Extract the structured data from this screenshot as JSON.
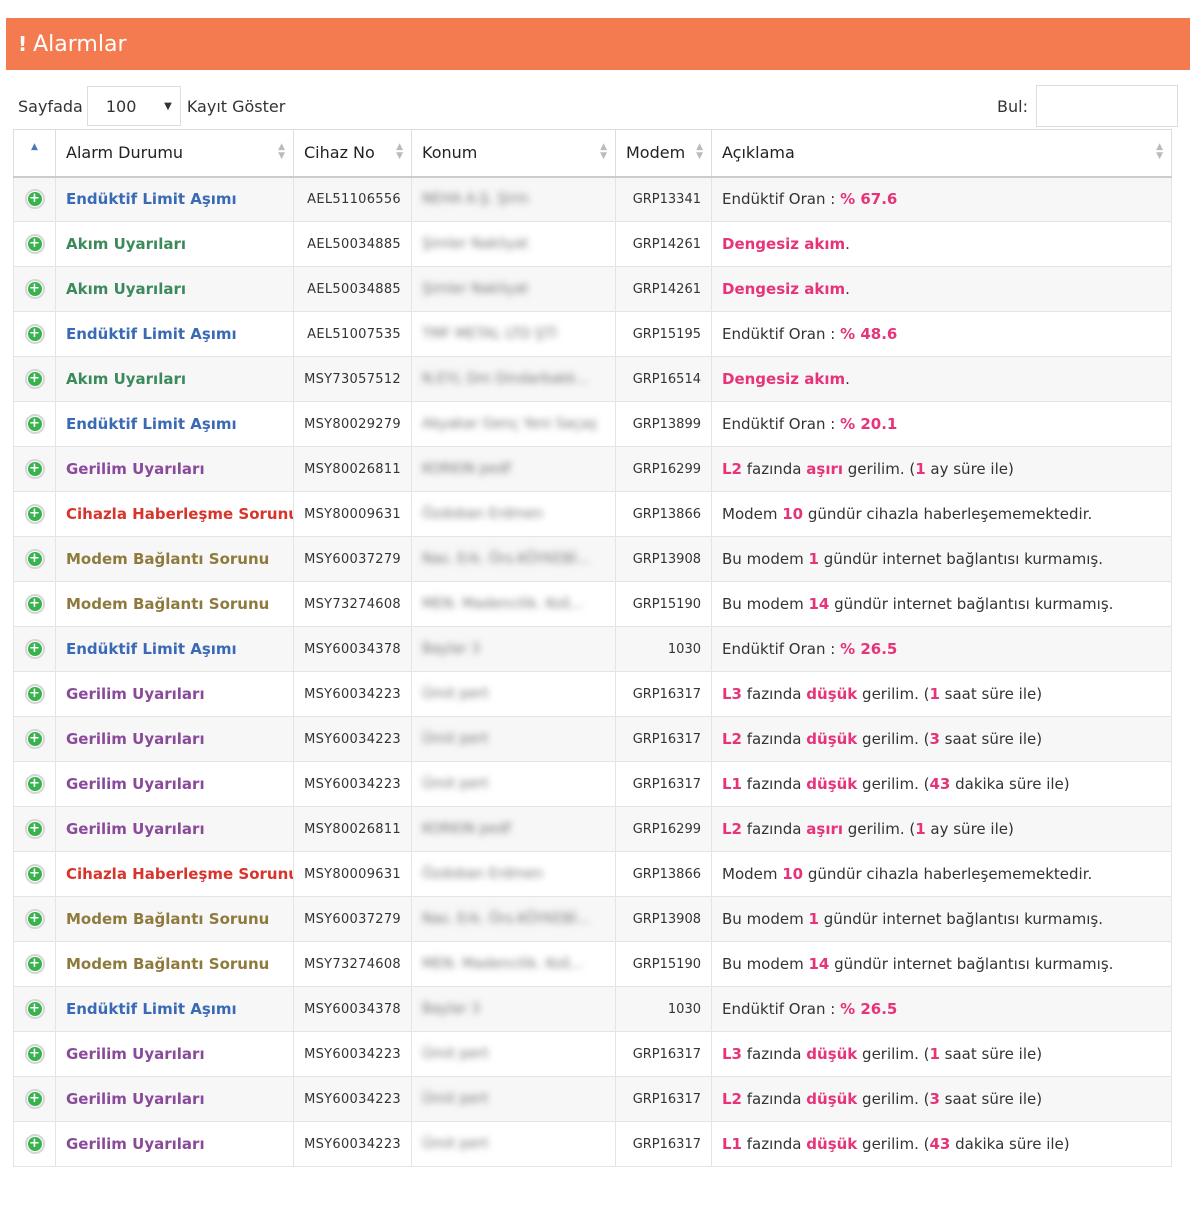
{
  "panel": {
    "title": "Alarmlar"
  },
  "length": {
    "prefix": "Sayfada",
    "value": "100",
    "suffix": "Kayıt Göster"
  },
  "search": {
    "label": "Bul:",
    "value": ""
  },
  "colors": {
    "header_bg": "#f47b4f",
    "Endüktif Limit Aşımı": "#3a6ab5",
    "Akım Uyarıları": "#3c8a5c",
    "Gerilim Uyarıları": "#8a4a9a",
    "Cihazla Haberleşme Sorunu": "#d9342b",
    "Modem Bağlantı Sorunu": "#8f7a3d",
    "highlight": "#e6337a"
  },
  "table": {
    "headers": [
      "",
      "Alarm Durumu",
      "Cihaz No",
      "Konum",
      "Modem",
      "Açıklama"
    ],
    "rows": [
      {
        "status": "Endüktif Limit Aşımı",
        "device": "AEL51106556",
        "location": "NEHA A.Ş. Şirin",
        "modem": "GRP13341",
        "desc": [
          [
            "Endüktif Oran : ",
            0
          ],
          [
            "% 67.6",
            1
          ]
        ]
      },
      {
        "status": "Akım Uyarıları",
        "device": "AEL50034885",
        "location": "Şimler Nakliyat",
        "modem": "GRP14261",
        "desc": [
          [
            "Dengesiz akım",
            1
          ],
          [
            ".",
            0
          ]
        ]
      },
      {
        "status": "Akım Uyarıları",
        "device": "AEL50034885",
        "location": "Şimler Nakliyat",
        "modem": "GRP14261",
        "desc": [
          [
            "Dengesiz akım",
            1
          ],
          [
            ".",
            0
          ]
        ]
      },
      {
        "status": "Endüktif Limit Aşımı",
        "device": "AEL51007535",
        "location": "TMF METAL LTD ŞTİ",
        "modem": "GRP15195",
        "desc": [
          [
            "Endüktif Oran : ",
            0
          ],
          [
            "% 48.6",
            1
          ]
        ]
      },
      {
        "status": "Akım Uyarıları",
        "device": "MSY73057512",
        "location": "N.EYL Dm Dindarbakk...",
        "modem": "GRP16514",
        "desc": [
          [
            "Dengesiz akım",
            1
          ],
          [
            ".",
            0
          ]
        ]
      },
      {
        "status": "Endüktif Limit Aşımı",
        "device": "MSY80029279",
        "location": "Akyakar Genç Yeni Saçaş",
        "modem": "GRP13899",
        "desc": [
          [
            "Endüktif Oran : ",
            0
          ],
          [
            "% 20.1",
            1
          ]
        ]
      },
      {
        "status": "Gerilim Uyarıları",
        "device": "MSY80026811",
        "location": "KORKIN pedf",
        "modem": "GRP16299",
        "desc": [
          [
            "L2",
            1
          ],
          [
            " fazında ",
            0
          ],
          [
            "aşırı",
            1
          ],
          [
            " gerilim. (",
            0
          ],
          [
            "1",
            1
          ],
          [
            " ay süre ile)",
            0
          ]
        ]
      },
      {
        "status": "Cihazla Haberleşme Sorunu",
        "device": "MSY80009631",
        "location": "Özdoban Erdmen",
        "modem": "GRP13866",
        "desc": [
          [
            "Modem ",
            0
          ],
          [
            "10",
            1
          ],
          [
            " gündür cihazla haberleşememektedir.",
            0
          ]
        ]
      },
      {
        "status": "Modem Bağlantı Sorunu",
        "device": "MSY60037279",
        "location": "Nas. Erk. Örs.KÖYKEBİ...",
        "modem": "GRP13908",
        "desc": [
          [
            "Bu modem ",
            0
          ],
          [
            "1",
            1
          ],
          [
            " gündür internet bağlantısı kurmamış.",
            0
          ]
        ]
      },
      {
        "status": "Modem Bağlantı Sorunu",
        "device": "MSY73274608",
        "location": "MEN. Madencilik. Koš...",
        "modem": "GRP15190",
        "desc": [
          [
            "Bu modem ",
            0
          ],
          [
            "14",
            1
          ],
          [
            " gündür internet bağlantısı kurmamış.",
            0
          ]
        ]
      },
      {
        "status": "Endüktif Limit Aşımı",
        "device": "MSY60034378",
        "location": "Baylar 3",
        "modem": "1030",
        "desc": [
          [
            "Endüktif Oran : ",
            0
          ],
          [
            "% 26.5",
            1
          ]
        ]
      },
      {
        "status": "Gerilim Uyarıları",
        "device": "MSY60034223",
        "location": "Ümit pert",
        "modem": "GRP16317",
        "desc": [
          [
            "L3",
            1
          ],
          [
            " fazında ",
            0
          ],
          [
            "düşük",
            1
          ],
          [
            " gerilim. (",
            0
          ],
          [
            "1",
            1
          ],
          [
            " saat süre ile)",
            0
          ]
        ]
      },
      {
        "status": "Gerilim Uyarıları",
        "device": "MSY60034223",
        "location": "Ümit pert",
        "modem": "GRP16317",
        "desc": [
          [
            "L2",
            1
          ],
          [
            " fazında ",
            0
          ],
          [
            "düşük",
            1
          ],
          [
            " gerilim. (",
            0
          ],
          [
            "3",
            1
          ],
          [
            " saat süre ile)",
            0
          ]
        ]
      },
      {
        "status": "Gerilim Uyarıları",
        "device": "MSY60034223",
        "location": "Ümit pert",
        "modem": "GRP16317",
        "desc": [
          [
            "L1",
            1
          ],
          [
            " fazında ",
            0
          ],
          [
            "düşük",
            1
          ],
          [
            " gerilim. (",
            0
          ],
          [
            "43",
            1
          ],
          [
            " dakika süre ile)",
            0
          ]
        ]
      },
      {
        "status": "Gerilim Uyarıları",
        "device": "MSY80026811",
        "location": "KORKIN pedf",
        "modem": "GRP16299",
        "desc": [
          [
            "L2",
            1
          ],
          [
            " fazında ",
            0
          ],
          [
            "aşırı",
            1
          ],
          [
            " gerilim. (",
            0
          ],
          [
            "1",
            1
          ],
          [
            " ay süre ile)",
            0
          ]
        ]
      },
      {
        "status": "Cihazla Haberleşme Sorunu",
        "device": "MSY80009631",
        "location": "Özdoban Erdmen",
        "modem": "GRP13866",
        "desc": [
          [
            "Modem ",
            0
          ],
          [
            "10",
            1
          ],
          [
            " gündür cihazla haberleşememektedir.",
            0
          ]
        ]
      },
      {
        "status": "Modem Bağlantı Sorunu",
        "device": "MSY60037279",
        "location": "Nas. Erk. Örs.KÖYKEBİ...",
        "modem": "GRP13908",
        "desc": [
          [
            "Bu modem ",
            0
          ],
          [
            "1",
            1
          ],
          [
            " gündür internet bağlantısı kurmamış.",
            0
          ]
        ]
      },
      {
        "status": "Modem Bağlantı Sorunu",
        "device": "MSY73274608",
        "location": "MEN. Madencilik. Koš...",
        "modem": "GRP15190",
        "desc": [
          [
            "Bu modem ",
            0
          ],
          [
            "14",
            1
          ],
          [
            " gündür internet bağlantısı kurmamış.",
            0
          ]
        ]
      },
      {
        "status": "Endüktif Limit Aşımı",
        "device": "MSY60034378",
        "location": "Baylar 3",
        "modem": "1030",
        "desc": [
          [
            "Endüktif Oran : ",
            0
          ],
          [
            "% 26.5",
            1
          ]
        ]
      },
      {
        "status": "Gerilim Uyarıları",
        "device": "MSY60034223",
        "location": "Ümit pert",
        "modem": "GRP16317",
        "desc": [
          [
            "L3",
            1
          ],
          [
            " fazında ",
            0
          ],
          [
            "düşük",
            1
          ],
          [
            " gerilim. (",
            0
          ],
          [
            "1",
            1
          ],
          [
            " saat süre ile)",
            0
          ]
        ]
      },
      {
        "status": "Gerilim Uyarıları",
        "device": "MSY60034223",
        "location": "Ümit pert",
        "modem": "GRP16317",
        "desc": [
          [
            "L2",
            1
          ],
          [
            " fazında ",
            0
          ],
          [
            "düşük",
            1
          ],
          [
            " gerilim. (",
            0
          ],
          [
            "3",
            1
          ],
          [
            " saat süre ile)",
            0
          ]
        ]
      },
      {
        "status": "Gerilim Uyarıları",
        "device": "MSY60034223",
        "location": "Ümit pert",
        "modem": "GRP16317",
        "desc": [
          [
            "L1",
            1
          ],
          [
            " fazında ",
            0
          ],
          [
            "düşük",
            1
          ],
          [
            " gerilim. (",
            0
          ],
          [
            "43",
            1
          ],
          [
            " dakika süre ile)",
            0
          ]
        ]
      }
    ]
  }
}
